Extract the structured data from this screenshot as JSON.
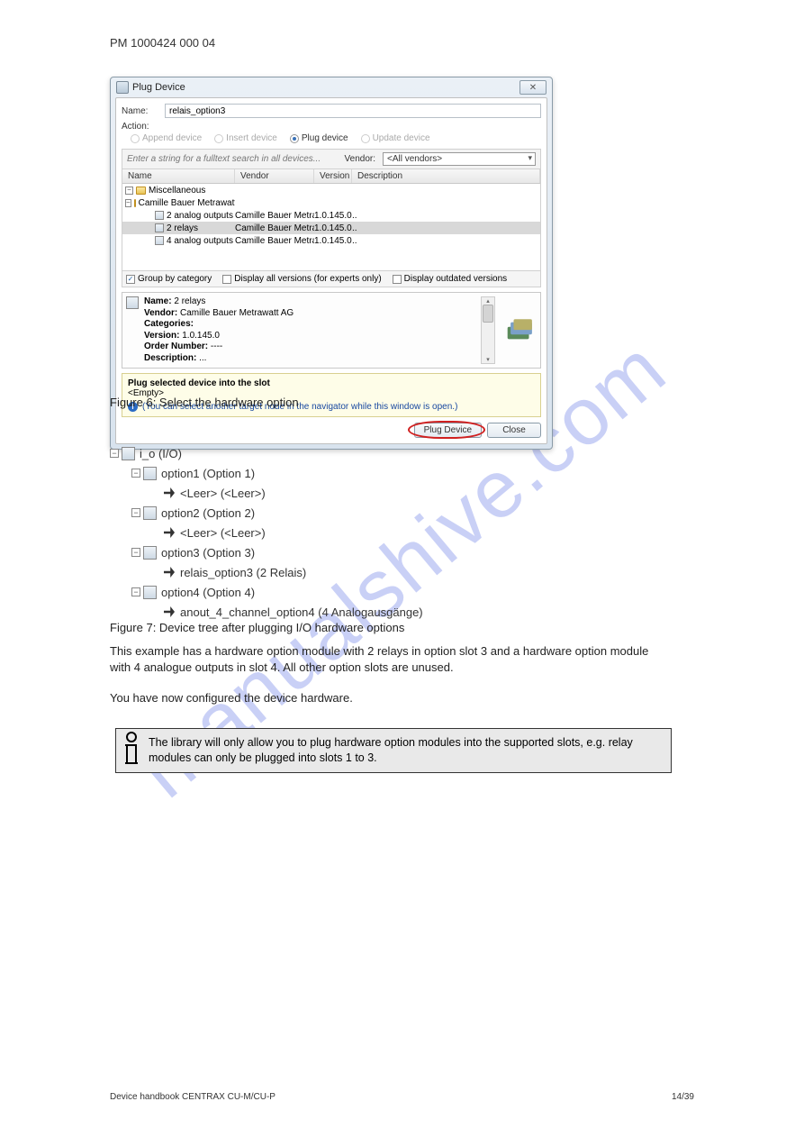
{
  "page_header": "PM 1000424 000 04",
  "dialog": {
    "title": "Plug Device",
    "close": "✕",
    "name_label": "Name:",
    "name_value": "relais_option3",
    "action_label": "Action:",
    "radios": {
      "append": "Append device",
      "insert": "Insert device",
      "plug": "Plug device",
      "update": "Update device"
    },
    "search_placeholder": "Enter a string for a fulltext search in all devices...",
    "vendor_label": "Vendor:",
    "vendor_value": "<All vendors>",
    "columns": {
      "name": "Name",
      "vendor": "Vendor",
      "version": "Version",
      "description": "Description"
    },
    "tree": {
      "root": "Miscellaneous",
      "folder": "Camille Bauer Metrawatt AG",
      "rows": [
        {
          "name": "2 analog outputs",
          "vendor": "Camille Bauer Metrawatt AG",
          "version": "1.0.145.0",
          "desc": "..",
          "sel": false
        },
        {
          "name": "2 relays",
          "vendor": "Camille Bauer Metrawatt AG",
          "version": "1.0.145.0",
          "desc": "..",
          "sel": true
        },
        {
          "name": "4 analog outputs",
          "vendor": "Camille Bauer Metrawatt AG",
          "version": "1.0.145.0",
          "desc": "..",
          "sel": false
        }
      ]
    },
    "options": {
      "group": "Group by category",
      "experts": "Display all versions (for experts only)",
      "outdated": "Display outdated versions"
    },
    "detail": {
      "name_lbl": "Name:",
      "name_val": "2 relays",
      "vendor_lbl": "Vendor:",
      "vendor_val": "Camille Bauer Metrawatt AG",
      "cat_lbl": "Categories:",
      "ver_lbl": "Version:",
      "ver_val": "1.0.145.0",
      "order_lbl": "Order Number:",
      "order_val": "----",
      "desc_lbl": "Description:",
      "desc_val": "..."
    },
    "hint": {
      "title": "Plug selected device into the slot",
      "empty": "<Empty>",
      "info": "(You can select another target node in the navigator while this window is open.)"
    },
    "buttons": {
      "plug": "Plug Device",
      "close": "Close"
    }
  },
  "figure6_label": "Figure 6: Select the hardware option",
  "device_tree": {
    "root": "i_o (I/O)",
    "nodes": [
      {
        "label": "option1 (Option 1)",
        "child": "<Leer> (<Leer>)"
      },
      {
        "label": "option2 (Option 2)",
        "child": "<Leer> (<Leer>)"
      },
      {
        "label": "option3 (Option 3)",
        "child": "relais_option3 (2 Relais)"
      },
      {
        "label": "option4 (Option 4)",
        "child": "anout_4_channel_option4 (4 Analogausgänge)"
      }
    ]
  },
  "figure7_label": "Figure 7: Device tree after plugging I/O hardware options",
  "paragraphs": {
    "p1": "This example has a hardware option module with 2 relays in option slot 3 and a hardware option module with 4 analogue outputs in slot 4. All other option slots are unused.",
    "p2": "You have now configured the device hardware."
  },
  "note_text": "The library will only allow you to plug hardware option modules into the supported slots, e.g. relay modules can only be plugged into slots 1 to 3.",
  "watermark": "manualshive.com",
  "footer": {
    "left": "Device handbook CENTRAX CU-M/CU-P",
    "right": "14/39"
  }
}
